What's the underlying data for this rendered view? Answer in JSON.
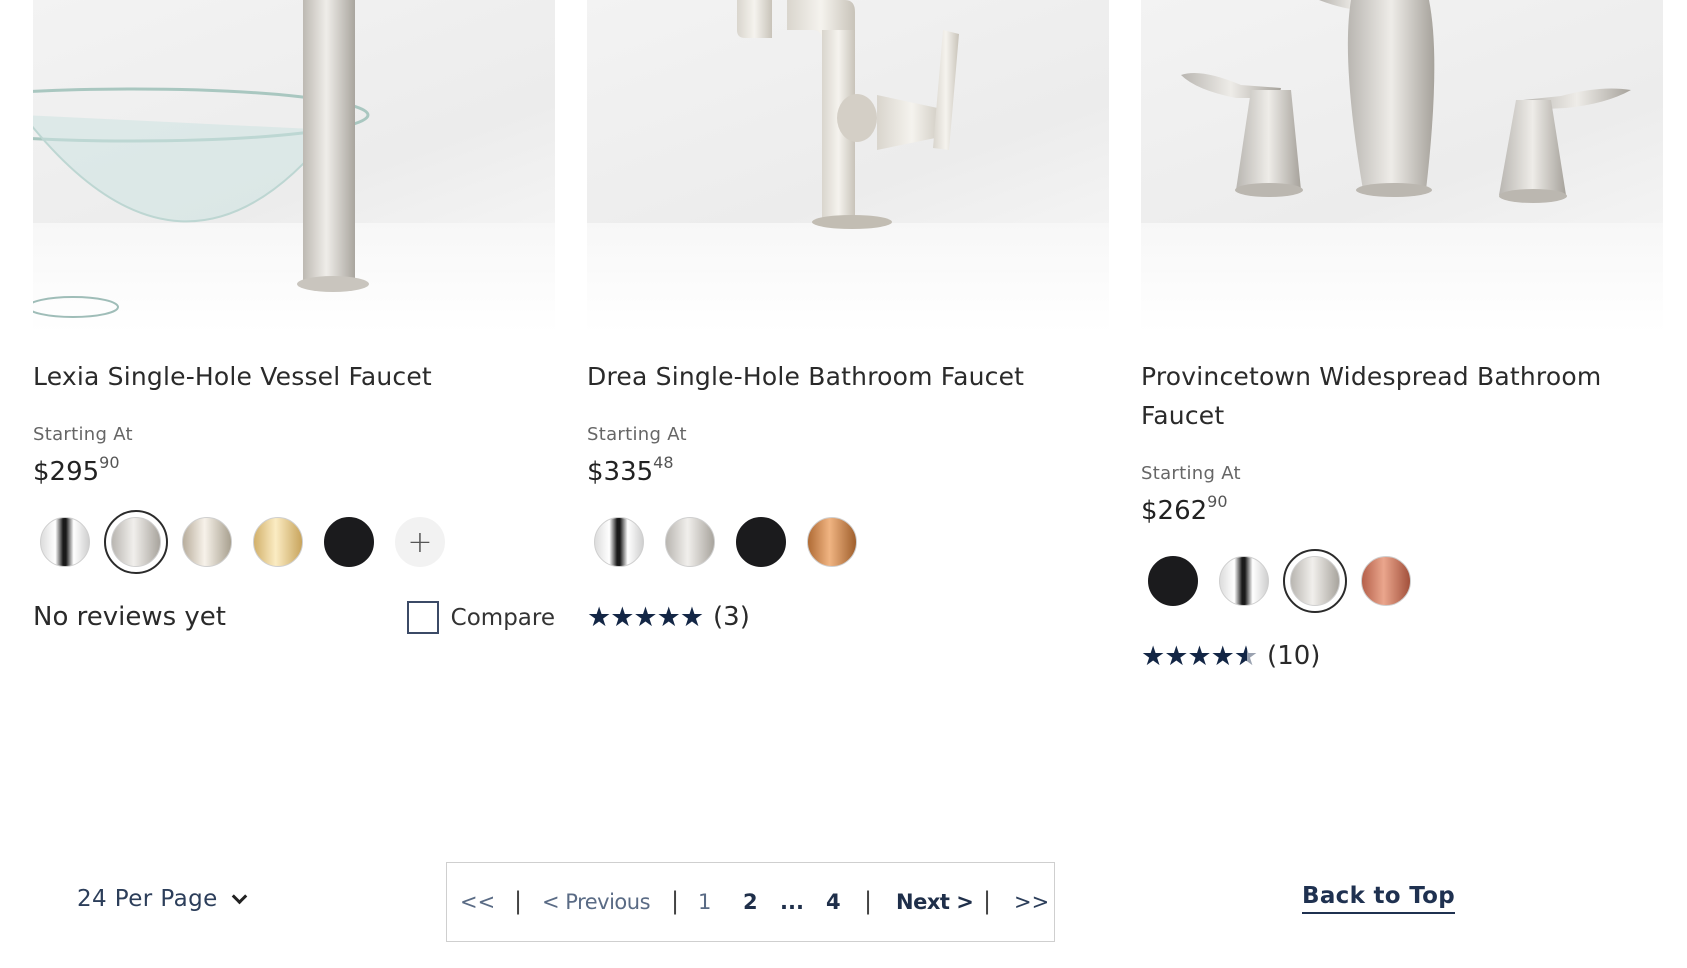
{
  "colors": {
    "star": "#132645",
    "link": "#1f3150"
  },
  "products": [
    {
      "title": "Lexia Single-Hole Vessel Faucet",
      "starting_label": "Starting At",
      "price_dollars": "$295",
      "price_cents": "90",
      "swatches": [
        "chrome",
        "brushed-nickel",
        "polished-nickel",
        "brushed-gold",
        "matte-black"
      ],
      "selected_swatch": 1,
      "more_label": "+",
      "reviews_text": "No reviews yet",
      "compare_label": "Compare"
    },
    {
      "title": "Drea Single-Hole Bathroom Faucet",
      "starting_label": "Starting At",
      "price_dollars": "$335",
      "price_cents": "48",
      "swatches": [
        "chrome",
        "brushed-nickel",
        "matte-black",
        "brushed-copper"
      ],
      "rating": 5,
      "stars_text": "★★★★★",
      "review_count": "(3)"
    },
    {
      "title": "Provincetown Widespread Bathroom Faucet",
      "starting_label": "Starting At",
      "price_dollars": "$262",
      "price_cents": "90",
      "swatches": [
        "matte-black",
        "chrome",
        "brushed-nickel",
        "copper"
      ],
      "selected_swatch": 2,
      "rating": 4.5,
      "stars_text": "★★★★",
      "half_star": "★",
      "review_count": "(10)"
    }
  ],
  "footer": {
    "per_page": "24 Per Page",
    "back_to_top": "Back to Top"
  },
  "pagination": {
    "first": "<<",
    "sep": "|",
    "previous": "< Previous",
    "page1": "1",
    "page2": "2",
    "ellipsis": "...",
    "page4": "4",
    "next": "Next >",
    "last": ">>",
    "current_page": 2
  }
}
